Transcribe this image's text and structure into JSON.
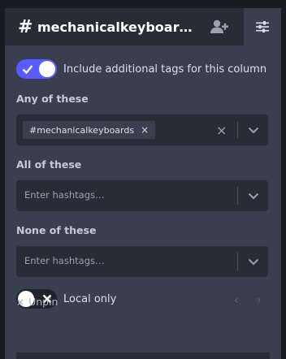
{
  "header": {
    "hash_symbol": "#",
    "title": "mechanicalkeyboard or m…",
    "follow_icon": "add-user-icon",
    "settings_icon": "sliders-icon"
  },
  "settings": {
    "include_toggle": {
      "checked": true,
      "label": "Include additional tags for this column"
    },
    "any_of": {
      "label": "Any of these",
      "tags": [
        "#mechanicalkeyboards"
      ],
      "tag_remove": "×",
      "clear": "×"
    },
    "all_of": {
      "label": "All of these",
      "placeholder": "Enter hashtags…"
    },
    "none_of": {
      "label": "None of these",
      "placeholder": "Enter hashtags…"
    },
    "local_only": {
      "checked": false,
      "label": "Local only"
    }
  },
  "footer": {
    "unpin_icon": "×",
    "unpin_label": "Unpin",
    "prev": "‹",
    "next": "›"
  },
  "colors": {
    "accent": "#595aff",
    "header_bg": "#282c37",
    "panel_bg": "#393f4f",
    "input_bg": "#282c37"
  }
}
